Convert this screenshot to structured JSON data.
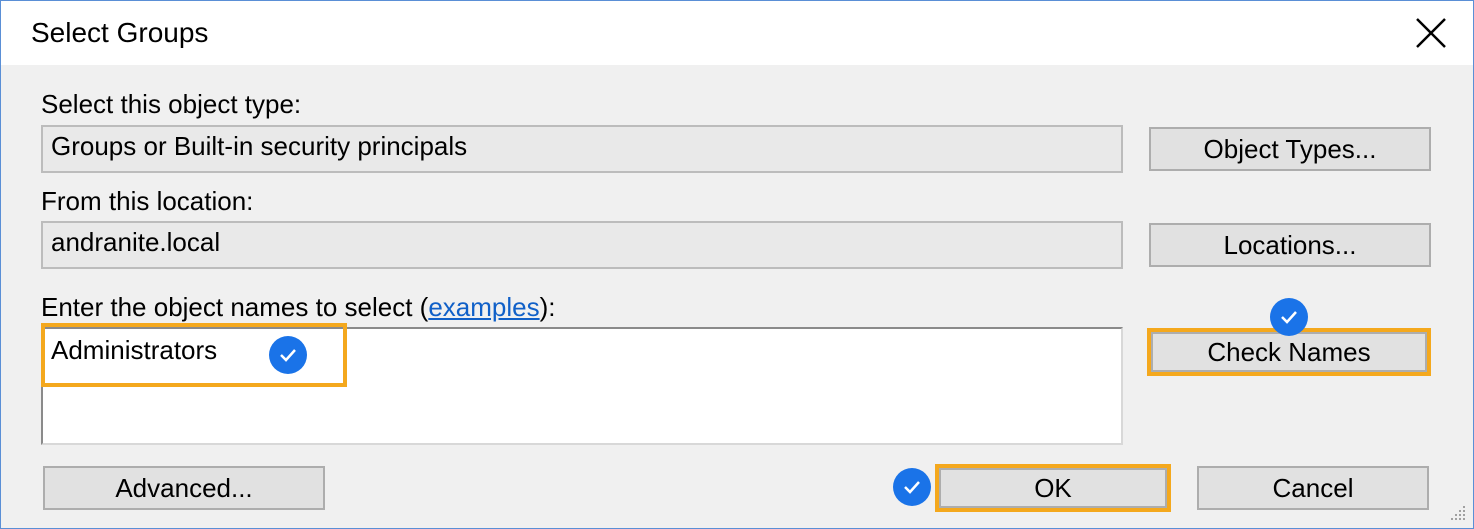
{
  "window": {
    "title": "Select Groups"
  },
  "object_type": {
    "label": "Select this object type:",
    "value": "Groups or Built-in security principals",
    "button": "Object Types..."
  },
  "location": {
    "label": "From this location:",
    "value": "andranite.local",
    "button": "Locations..."
  },
  "names": {
    "label_prefix": "Enter the object names to select (",
    "link": "examples",
    "label_suffix": "):",
    "value": "Administrators",
    "check_button": "Check Names"
  },
  "footer": {
    "advanced": "Advanced...",
    "ok": "OK",
    "cancel": "Cancel"
  },
  "colors": {
    "highlight": "#f4a81d",
    "check_badge": "#1a73e8",
    "link": "#1060c8"
  }
}
